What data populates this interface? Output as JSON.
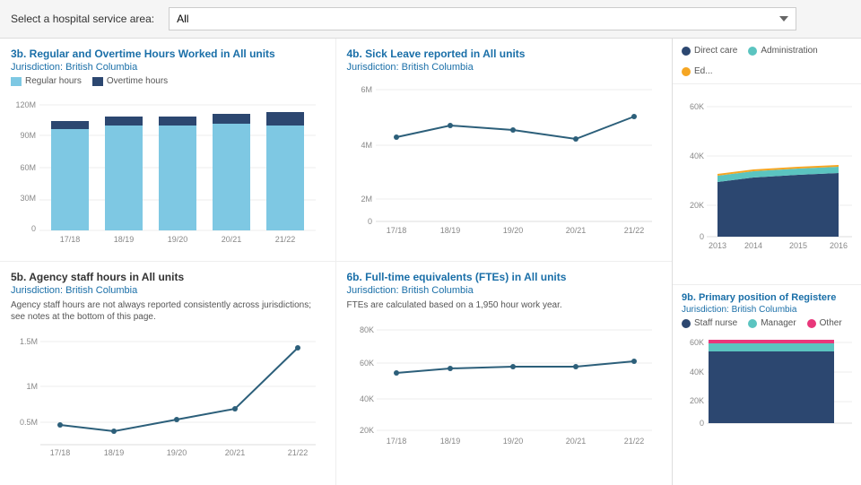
{
  "topbar": {
    "label": "Select a hospital service area:",
    "dropdown_value": "All"
  },
  "legend_top": [
    {
      "id": "direct-care",
      "label": "Direct care",
      "color": "#2c4770",
      "type": "dot"
    },
    {
      "id": "administration",
      "label": "Administration",
      "color": "#5bc4c0",
      "type": "dot"
    },
    {
      "id": "education",
      "label": "Ed...",
      "color": "#f5a623",
      "type": "dot"
    }
  ],
  "charts": {
    "chart3b": {
      "title_prefix": "3b. Regular and Overtime Hours Worked ",
      "title_highlight": "in All units",
      "jurisdiction": "Jurisdiction: British Columbia",
      "legend": [
        {
          "label": "Regular hours",
          "color": "#7ec8e3",
          "type": "rect"
        },
        {
          "label": "Overtime hours",
          "color": "#2c4770",
          "type": "rect"
        }
      ],
      "y_labels": [
        "120M",
        "90M",
        "60M",
        "30M",
        "0"
      ],
      "x_labels": [
        "17/18",
        "18/19",
        "19/20",
        "20/21",
        "21/22"
      ],
      "bars": [
        {
          "regular": 85,
          "overtime": 7
        },
        {
          "regular": 88,
          "overtime": 8
        },
        {
          "regular": 87,
          "overtime": 8
        },
        {
          "regular": 89,
          "overtime": 9
        },
        {
          "regular": 88,
          "overtime": 12
        }
      ]
    },
    "chart4b": {
      "title_prefix": "4b. Sick Leave reported ",
      "title_highlight": "in All units",
      "jurisdiction": "Jurisdiction: British Columbia",
      "y_labels": [
        "6M",
        "4M",
        "2M",
        "0"
      ],
      "x_labels": [
        "17/18",
        "18/19",
        "19/20",
        "20/21",
        "21/22"
      ],
      "points": [
        55,
        60,
        58,
        55,
        75
      ]
    },
    "chart5b": {
      "title": "5b. Agency staff hours in All units",
      "jurisdiction": "Jurisdiction: British Columbia",
      "subtitle": "Agency staff hours are not always reported consistently across jurisdictions; see notes at the bottom of this page.",
      "y_labels": [
        "1.5M",
        "1M",
        "0.5M"
      ],
      "x_labels": [
        "17/18",
        "18/19",
        "19/20",
        "20/21",
        "21/22"
      ],
      "points": [
        22,
        15,
        22,
        35,
        72
      ]
    },
    "chart6b": {
      "title_prefix": "6b. Full-time equivalents (FTEs) ",
      "title_highlight": "in All units",
      "jurisdiction": "Jurisdiction: British Columbia",
      "subtitle": "FTEs are calculated based on a 1,950 hour work year.",
      "y_labels": [
        "80K",
        "60K",
        "40K",
        "20K"
      ],
      "x_labels": [
        "17/18",
        "18/19",
        "19/20",
        "20/21",
        "21/22"
      ],
      "points": [
        45,
        47,
        47,
        47,
        50
      ]
    }
  },
  "right_top_chart": {
    "y_labels": [
      "60K",
      "40K",
      "20K",
      "0"
    ],
    "x_labels": [
      "2013",
      "2014",
      "2015",
      "2016"
    ]
  },
  "chart9b": {
    "title_prefix": "9b. Primary position of ",
    "title_highlight": "Registere",
    "jurisdiction": "Jurisdiction: British Columbia",
    "legend": [
      {
        "label": "Staff nurse",
        "color": "#2c4770",
        "type": "dot"
      },
      {
        "label": "Manager",
        "color": "#5bc4c0",
        "type": "dot"
      },
      {
        "label": "Other",
        "color": "#e8377a",
        "type": "dot"
      }
    ],
    "y_labels": [
      "60K",
      "40K",
      "20K",
      "0"
    ]
  }
}
